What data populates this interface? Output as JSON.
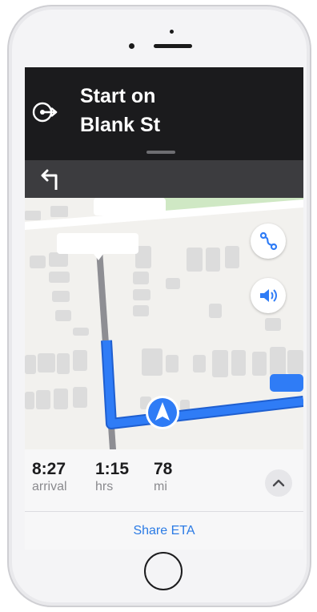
{
  "navigation": {
    "instruction_line1": "Start on",
    "instruction_line2": "Blank St",
    "maneuver_icon": "start-route-icon",
    "next_maneuver_icon": "turn-left-icon"
  },
  "map": {
    "route_color": "#2f7cf6",
    "route_overview_icon": "route-overview-icon",
    "audio_icon": "speaker-icon",
    "location_icon": "navigation-arrow-icon"
  },
  "trip": {
    "arrival_value": "8:27",
    "arrival_unit": "arrival",
    "duration_value": "1:15",
    "duration_unit": "hrs",
    "distance_value": "78",
    "distance_unit": "mi",
    "expand_icon": "chevron-up-icon",
    "share_label": "Share ETA"
  }
}
